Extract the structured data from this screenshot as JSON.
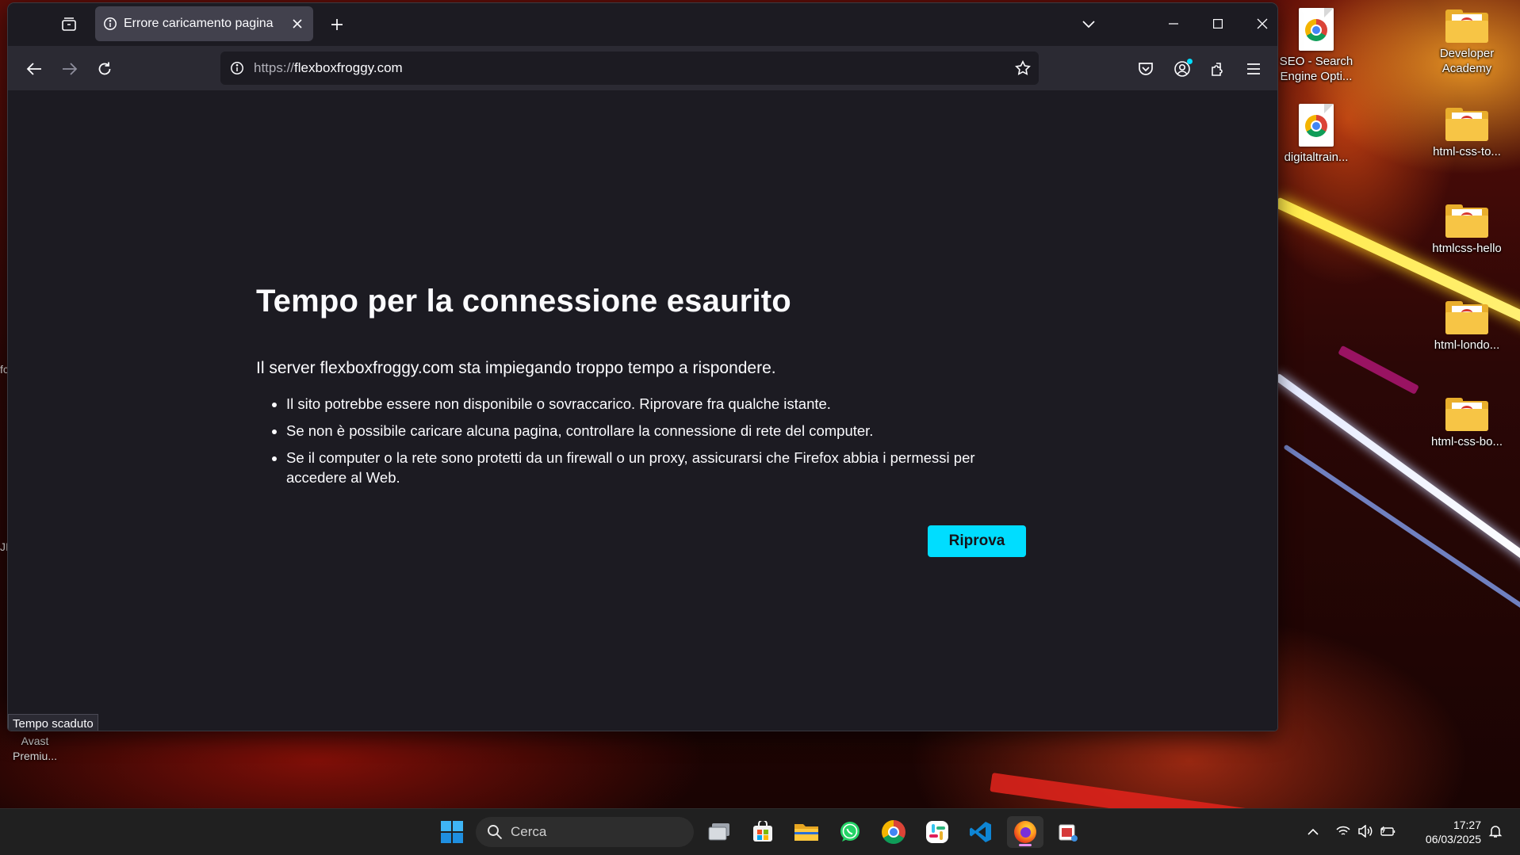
{
  "browser": {
    "tab": {
      "title": "Errore caricamento pagina"
    },
    "url": {
      "scheme": "https://",
      "host": "flexboxfroggy.com"
    },
    "error": {
      "title": "Tempo per la connessione esaurito",
      "description": "Il server flexboxfroggy.com sta impiegando troppo tempo a rispondere.",
      "suggestions": [
        "Il sito potrebbe essere non disponibile o sovraccarico. Riprovare fra qualche istante.",
        "Se non è possibile caricare alcuna pagina, controllare la connessione di rete del computer.",
        "Se il computer o la rete sono protetti da un firewall o un proxy, assicurarsi che Firefox abbia i permessi per accedere al Web."
      ],
      "retry_label": "Riprova"
    },
    "status_text": "Tempo scaduto"
  },
  "desktop": {
    "icons": [
      {
        "label": "SEO - Search Engine Opti...",
        "type": "chrome-shortcut"
      },
      {
        "label": "Developer Academy",
        "type": "folder"
      },
      {
        "label": "digitaltrain...",
        "type": "chrome-shortcut"
      },
      {
        "label": "html-css-to...",
        "type": "folder"
      },
      {
        "label": "htmlcss-hello",
        "type": "folder"
      },
      {
        "label": "html-londo...",
        "type": "folder"
      },
      {
        "label": "html-css-bo...",
        "type": "folder"
      }
    ],
    "partial_labels": {
      "avast": "Avast Premiu...",
      "left_edge_1": "fc",
      "left_edge_2": "JI"
    }
  },
  "taskbar": {
    "search_placeholder": "Cerca",
    "apps": [
      "windows-start",
      "task-view",
      "microsoft-store",
      "file-explorer",
      "whatsapp",
      "chrome",
      "slack",
      "vscode",
      "firefox",
      "snipping-tool"
    ],
    "clock": {
      "time": "17:27",
      "date": "06/03/2025"
    }
  },
  "colors": {
    "accent": "#00ddff",
    "page_bg": "#1c1b22",
    "toolbar_bg": "#2b2a33",
    "taskbar_bg": "#202020"
  }
}
